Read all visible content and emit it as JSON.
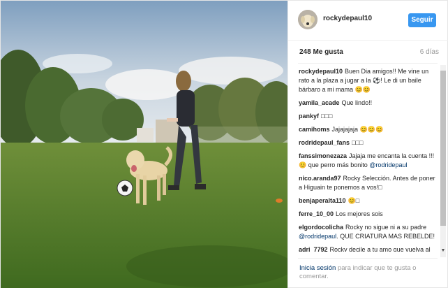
{
  "post": {
    "username": "rockydepaul10",
    "follow_label": "Seguir",
    "likes": "248 Me gusta",
    "age": "6 días"
  },
  "comments": [
    {
      "user": "rockydepaul10",
      "text": "Buen Dia amigos!! Me vine un rato a la plaza a jugar a la ⚽! Le di un baile bárbaro a mi mama 😊😊"
    },
    {
      "user": "yamila_acade",
      "text": "Que lindo!!"
    },
    {
      "user": "pankyf",
      "text": "□□□"
    },
    {
      "user": "camihoms",
      "text": "Jajajajaja 😊😊😊"
    },
    {
      "user": "rodridepaul_fans",
      "text": "□□□"
    },
    {
      "user": "fanssimonezaza",
      "text": "Jajaja me encanta la cuenta !!! 😊 que perro más bonito",
      "mention": "@rodridepaul"
    },
    {
      "user": "nico.aranda97",
      "text": "Rocky Selección. Antes de poner a Higuain te ponemos a vos!□"
    },
    {
      "user": "benjaperalta110",
      "text": "😊□"
    },
    {
      "user": "ferre_10_00",
      "text": "Los mejores sois"
    },
    {
      "user": "elgordocolicha",
      "text": "Rocky no sigue ni a su padre",
      "mention": "@rodridepaul",
      "text_after": ". QUE CRIATURA MAS REBELDE!"
    },
    {
      "user": "adri_7792",
      "text": "Rocky decile a tu amo que vuelva al Valencia que aca lo queremos"
    }
  ],
  "footer": {
    "login_link": "Inicia sesión",
    "login_text": "para indicar que te gusta o comentar."
  },
  "icons": {
    "avatar": "avatar-dog-photo",
    "scroll_down": "triangle-down-icon"
  }
}
